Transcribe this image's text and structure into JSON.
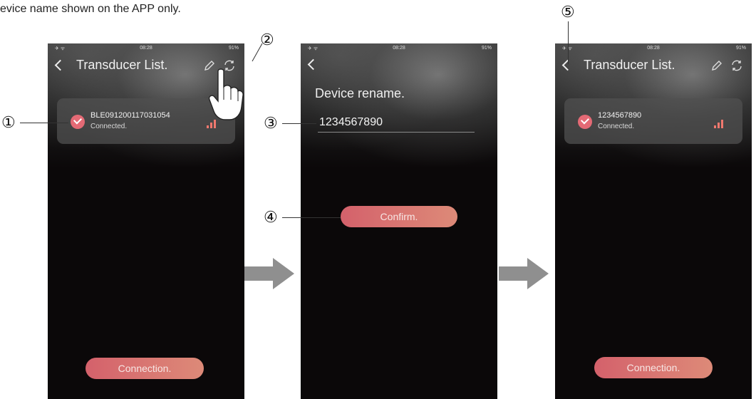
{
  "intro_text": "evice name shown on the APP only.",
  "colors": {
    "accent_start": "#d4616b",
    "accent_end": "#dd8a78",
    "signal": "#f0786e",
    "check": "#e46a75"
  },
  "callouts": [
    "①",
    "②",
    "③",
    "④",
    "⑤"
  ],
  "screen1": {
    "status_time": "08:28",
    "status_battery": "91%",
    "title": "Transducer List.",
    "device_name": "BLE091200117031054",
    "device_status": "Connected.",
    "connection_button": "Connection.",
    "icons": [
      "back-icon",
      "pencil-icon",
      "refresh-icon",
      "check-icon",
      "signal-icon"
    ]
  },
  "screen2": {
    "status_time": "08:28",
    "status_battery": "91%",
    "heading": "Device rename.",
    "input_value": "1234567890",
    "confirm_button": "Confirm."
  },
  "screen3": {
    "status_time": "08:28",
    "status_battery": "91%",
    "title": "Transducer List.",
    "device_name": "1234567890",
    "device_status": "Connected.",
    "connection_button": "Connection."
  }
}
